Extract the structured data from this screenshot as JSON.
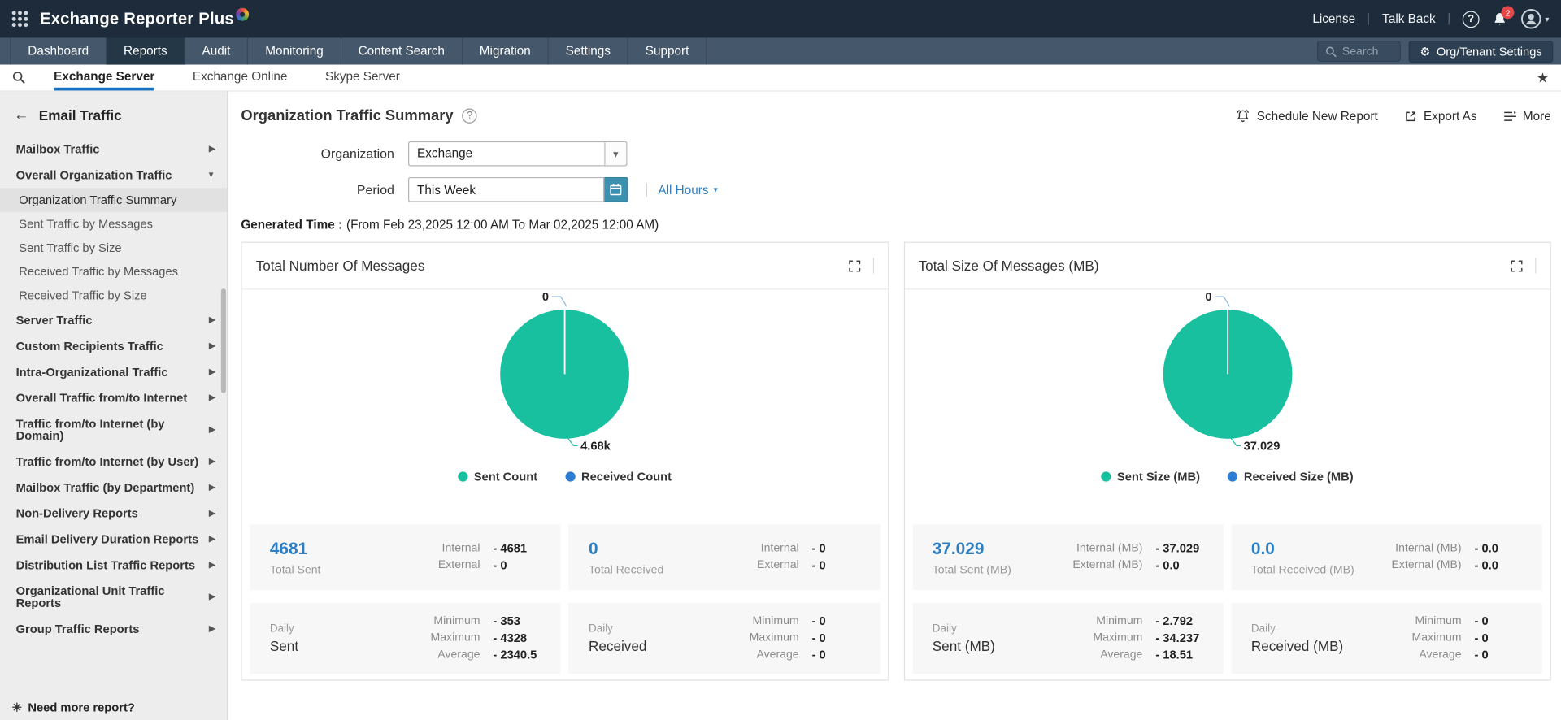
{
  "topbar": {
    "app_name": "Exchange Reporter Plus",
    "license": "License",
    "talk_back": "Talk Back",
    "help_glyph": "?",
    "notification_count": "2"
  },
  "nav": {
    "tabs": [
      "Dashboard",
      "Reports",
      "Audit",
      "Monitoring",
      "Content Search",
      "Migration",
      "Settings",
      "Support"
    ],
    "active_tab": "Reports",
    "search_placeholder": "Search",
    "settings_button": "Org/Tenant Settings"
  },
  "subnav": {
    "tabs": [
      "Exchange Server",
      "Exchange Online",
      "Skype Server"
    ],
    "active_tab": "Exchange Server"
  },
  "sidebar": {
    "back_glyph": "←",
    "title": "Email Traffic",
    "item_mailbox": "Mailbox Traffic",
    "group_overall": "Overall Organization Traffic",
    "children": [
      "Organization Traffic Summary",
      "Sent Traffic by Messages",
      "Sent Traffic by Size",
      "Received Traffic by Messages",
      "Received Traffic by Size"
    ],
    "active_child": "Organization Traffic Summary",
    "items": [
      "Server Traffic",
      "Custom Recipients Traffic",
      "Intra-Organizational Traffic",
      "Overall Traffic from/to Internet",
      "Traffic from/to Internet (by Domain)",
      "Traffic from/to Internet (by User)",
      "Mailbox Traffic (by Department)",
      "Non-Delivery Reports",
      "Email Delivery Duration Reports",
      "Distribution List Traffic Reports",
      "Organizational Unit Traffic Reports",
      "Group Traffic Reports"
    ],
    "footer": "Need more report?"
  },
  "content": {
    "title": "Organization Traffic Summary",
    "actions": {
      "schedule": "Schedule New Report",
      "export": "Export As",
      "more": "More"
    },
    "filters": {
      "organization_label": "Organization",
      "organization_value": "Exchange",
      "period_label": "Period",
      "period_value": "This Week",
      "hours_value": "All Hours"
    },
    "generated_label": "Generated Time :",
    "generated_range": "(From Feb 23,2025 12:00 AM To Mar 02,2025 12:00 AM)",
    "cards": [
      {
        "title": "Total Number Of Messages",
        "pie": {
          "top_label": "0",
          "bottom_label": "4.68k"
        },
        "legend": [
          "Sent Count",
          "Received Count"
        ],
        "stats": [
          {
            "value": "4681",
            "caption": "Total Sent",
            "rows": [
              {
                "k": "Internal",
                "v": "- 4681"
              },
              {
                "k": "External",
                "v": "- 0"
              }
            ]
          },
          {
            "value": "0",
            "caption": "Total Received",
            "rows": [
              {
                "k": "Internal",
                "v": "- 0"
              },
              {
                "k": "External",
                "v": "- 0"
              }
            ]
          },
          {
            "label_small": "Daily",
            "label": "Sent",
            "rows": [
              {
                "k": "Minimum",
                "v": "- 353"
              },
              {
                "k": "Maximum",
                "v": "- 4328"
              },
              {
                "k": "Average",
                "v": "- 2340.5"
              }
            ]
          },
          {
            "label_small": "Daily",
            "label": "Received",
            "rows": [
              {
                "k": "Minimum",
                "v": "- 0"
              },
              {
                "k": "Maximum",
                "v": "- 0"
              },
              {
                "k": "Average",
                "v": "- 0"
              }
            ]
          }
        ]
      },
      {
        "title": "Total Size Of Messages (MB)",
        "pie": {
          "top_label": "0",
          "bottom_label": "37.029"
        },
        "legend": [
          "Sent Size (MB)",
          "Received Size (MB)"
        ],
        "stats": [
          {
            "value": "37.029",
            "caption": "Total Sent (MB)",
            "rows": [
              {
                "k": "Internal (MB)",
                "v": "- 37.029"
              },
              {
                "k": "External (MB)",
                "v": "- 0.0"
              }
            ]
          },
          {
            "value": "0.0",
            "caption": "Total Received (MB)",
            "rows": [
              {
                "k": "Internal (MB)",
                "v": "- 0.0"
              },
              {
                "k": "External (MB)",
                "v": "- 0.0"
              }
            ]
          },
          {
            "label_small": "Daily",
            "label": "Sent (MB)",
            "rows": [
              {
                "k": "Minimum",
                "v": "- 2.792"
              },
              {
                "k": "Maximum",
                "v": "- 34.237"
              },
              {
                "k": "Average",
                "v": "- 18.51"
              }
            ]
          },
          {
            "label_small": "Daily",
            "label": "Received (MB)",
            "rows": [
              {
                "k": "Minimum",
                "v": "- 0"
              },
              {
                "k": "Maximum",
                "v": "- 0"
              },
              {
                "k": "Average",
                "v": "- 0"
              }
            ]
          }
        ]
      }
    ]
  },
  "colors": {
    "sent_series": "#19c0a0",
    "received_series": "#2d7ed3",
    "accent_blue": "#2e7fc2",
    "topbar_bg": "#1d2b3a",
    "nav_bg": "#45576b",
    "nav_active_bg": "#233747",
    "calendar_button_bg": "#3d91b0",
    "subnav_active_underline": "#1a73c0"
  },
  "chart_data": [
    {
      "type": "pie",
      "title": "Total Number Of Messages",
      "labels": [
        "Sent Count",
        "Received Count"
      ],
      "values": [
        4681,
        0
      ],
      "data_labels": [
        "4.68k",
        "0"
      ],
      "legend_position": "bottom"
    },
    {
      "type": "pie",
      "title": "Total Size Of Messages (MB)",
      "labels": [
        "Sent Size (MB)",
        "Received Size (MB)"
      ],
      "values": [
        37.029,
        0.0
      ],
      "data_labels": [
        "37.029",
        "0"
      ],
      "legend_position": "bottom"
    }
  ]
}
